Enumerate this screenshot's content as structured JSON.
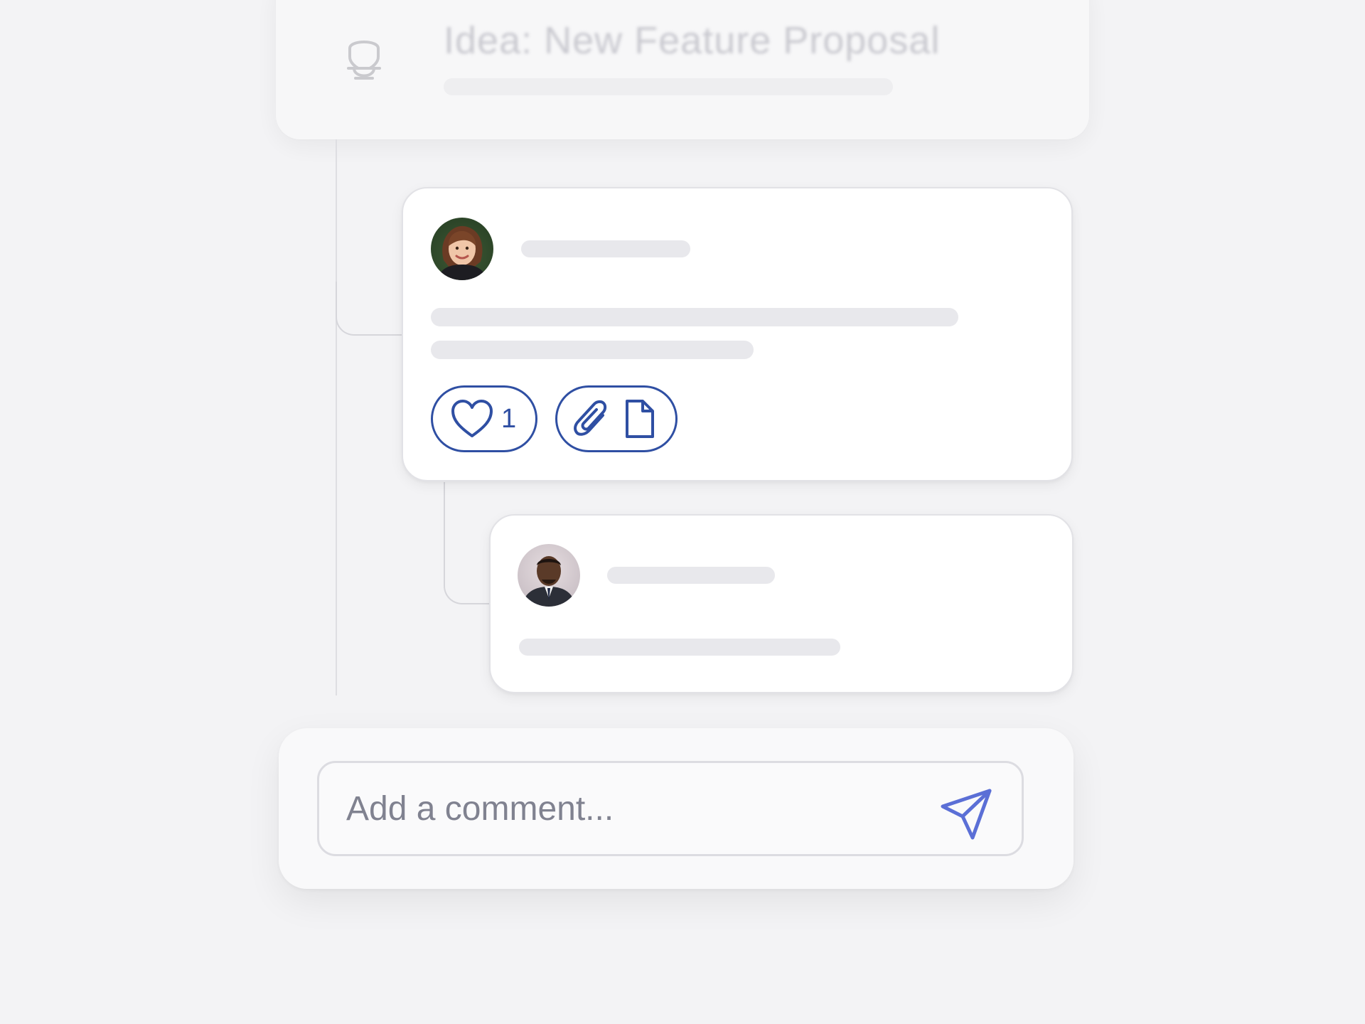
{
  "idea": {
    "title": "Idea: New Feature Proposal",
    "icon": "lightbulb-icon"
  },
  "thread": {
    "comments": [
      {
        "avatar": "avatar-woman",
        "likes": "1",
        "actions": [
          "heart-icon",
          "paperclip-icon",
          "document-icon"
        ]
      },
      {
        "avatar": "avatar-man"
      }
    ]
  },
  "composer": {
    "placeholder": "Add a comment...",
    "send_icon": "send-icon"
  },
  "colors": {
    "accent": "#2f4fa3",
    "send": "#5b6fd6",
    "skeleton": "#e8e8ec",
    "background": "#f3f3f5"
  }
}
